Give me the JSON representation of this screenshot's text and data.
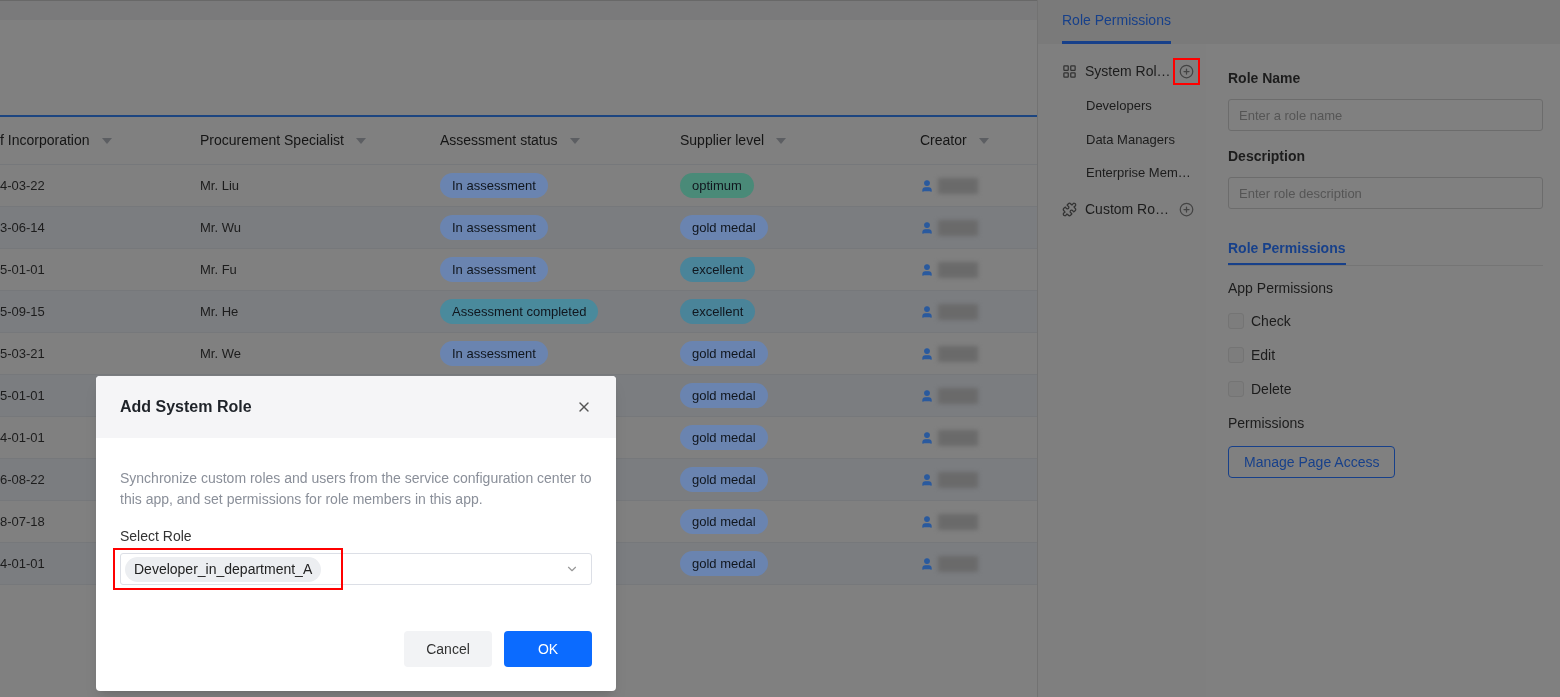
{
  "table": {
    "columns": [
      {
        "label": "f Incorporation"
      },
      {
        "label": "Procurement Specialist"
      },
      {
        "label": "Assessment status"
      },
      {
        "label": "Supplier level"
      },
      {
        "label": "Creator"
      }
    ],
    "rows": [
      {
        "date": "4-03-22",
        "specialist": "Mr. Liu",
        "status": {
          "label": "In assessment",
          "color": "#6a84b0"
        },
        "level": {
          "label": "optimum",
          "color": "#4a8a78"
        }
      },
      {
        "date": "3-06-14",
        "specialist": "Mr. Wu",
        "status": {
          "label": "In assessment",
          "color": "#6a84b0"
        },
        "level": {
          "label": "gold medal",
          "color": "#6a84b0"
        }
      },
      {
        "date": "5-01-01",
        "specialist": "Mr. Fu",
        "status": {
          "label": "In assessment",
          "color": "#6a84b0"
        },
        "level": {
          "label": "excellent",
          "color": "#4a8499"
        }
      },
      {
        "date": "5-09-15",
        "specialist": "Mr. He",
        "status": {
          "label": "Assessment completed",
          "color": "#4a8a9c"
        },
        "level": {
          "label": "excellent",
          "color": "#4a8499"
        }
      },
      {
        "date": "5-03-21",
        "specialist": "Mr. We",
        "status": {
          "label": "In assessment",
          "color": "#6a84b0"
        },
        "level": {
          "label": "gold medal",
          "color": "#6a84b0"
        }
      },
      {
        "date": "5-01-01",
        "level": {
          "label": "gold medal",
          "color": "#6a84b0"
        }
      },
      {
        "date": "4-01-01",
        "level": {
          "label": "gold medal",
          "color": "#6a84b0"
        }
      },
      {
        "date": "6-08-22",
        "level": {
          "label": "gold medal",
          "color": "#6a84b0"
        }
      },
      {
        "date": "8-07-18",
        "level": {
          "label": "gold medal",
          "color": "#6a84b0"
        }
      },
      {
        "date": "4-01-01",
        "level": {
          "label": "gold medal",
          "color": "#6a84b0"
        }
      }
    ]
  },
  "panel": {
    "tabs": [
      {
        "label": "Role Permissions",
        "selected": true
      }
    ],
    "groups": [
      {
        "kind": "system",
        "label": "System Rol…",
        "add_highlighted": true,
        "items": [
          {
            "label": "Developers"
          },
          {
            "label": "Data Managers"
          },
          {
            "label": "Enterprise Mem…"
          }
        ]
      },
      {
        "kind": "custom",
        "label": "Custom Ro…",
        "add_highlighted": false
      }
    ],
    "form": {
      "name_label": "Role Name",
      "name_placeholder": "Enter a role name",
      "desc_label": "Description",
      "desc_placeholder": "Enter role description",
      "section_tab": "Role Permissions",
      "app_label": "App Permissions",
      "options": [
        {
          "label": "Check",
          "checked": false
        },
        {
          "label": "Edit",
          "checked": false
        },
        {
          "label": "Delete",
          "checked": false
        }
      ],
      "perm_label": "Permissions",
      "button": "Manage Page Access"
    }
  },
  "dialog": {
    "title": "Add System Role",
    "description": "Synchronize custom roles and users from the service configuration center to this app, and set permissions for role members in this app.",
    "select_label": "Select Role",
    "selected_tags": [
      "Developer_in_department_A"
    ],
    "select_highlighted": true,
    "buttons": [
      {
        "kind": "secondary",
        "label": "Cancel"
      },
      {
        "kind": "primary",
        "label": "OK"
      }
    ]
  }
}
